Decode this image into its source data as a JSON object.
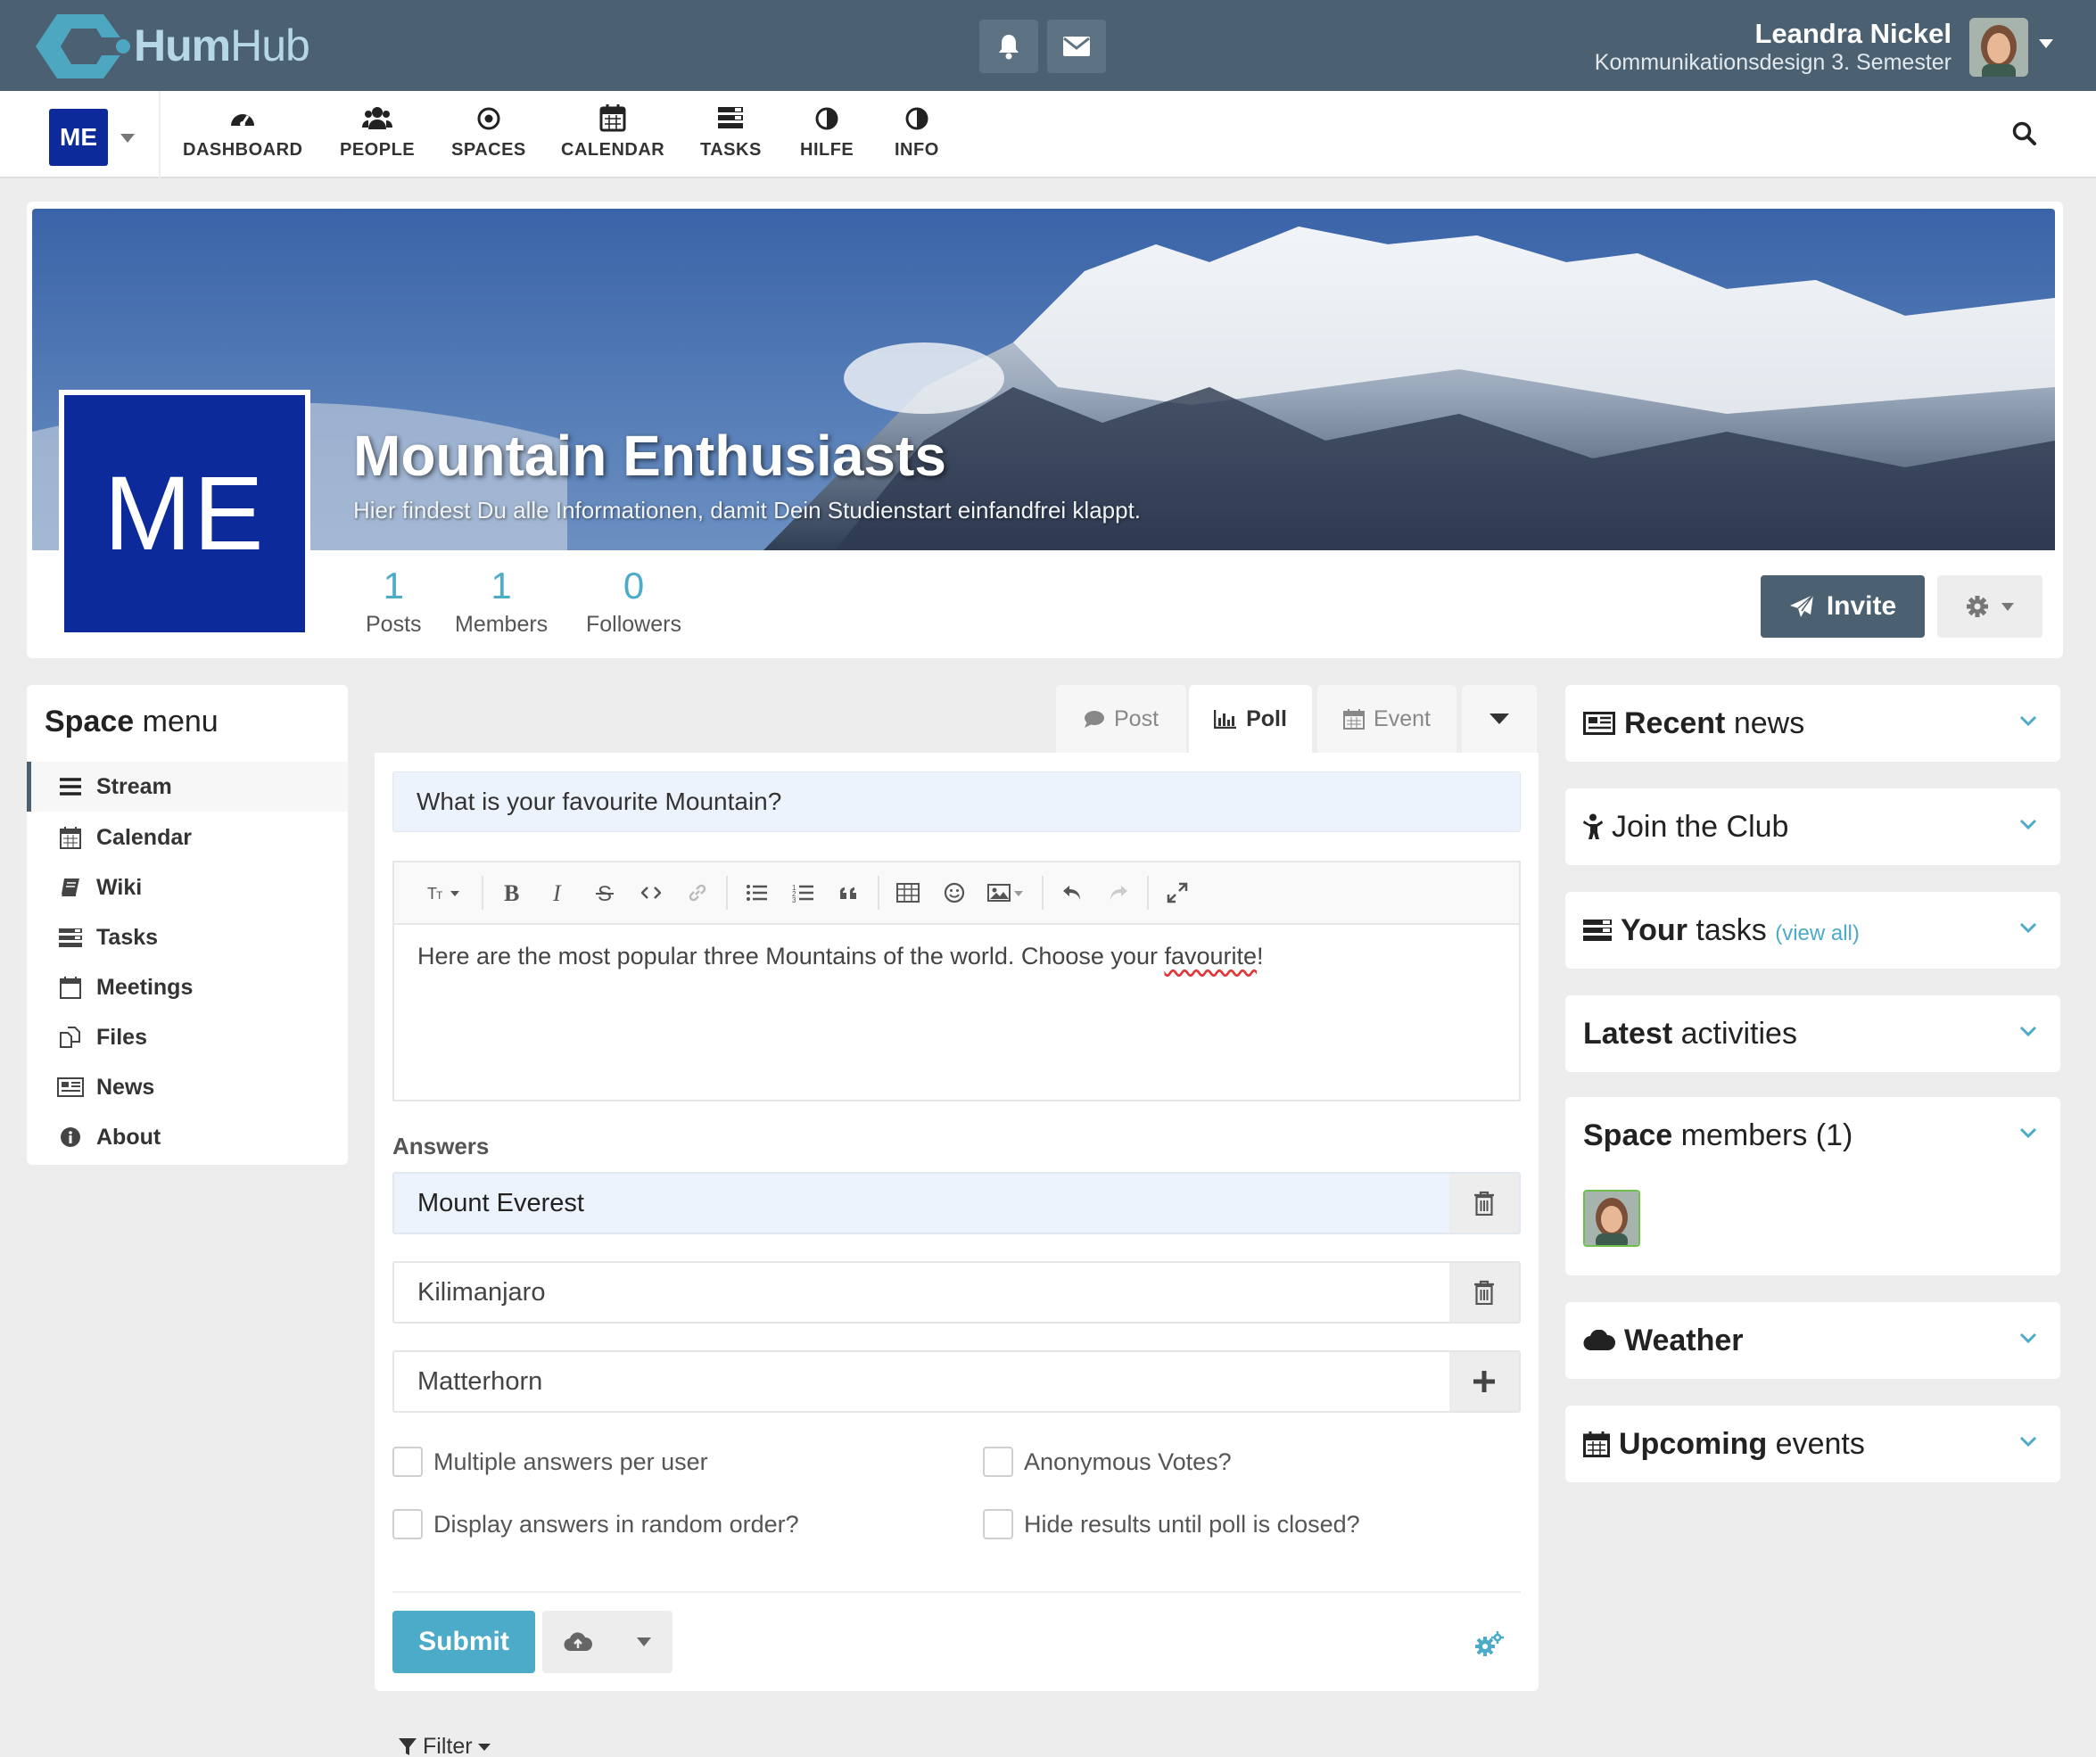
{
  "topbar": {
    "logo_text_bold": "Hum",
    "logo_text_light": "Hub",
    "user_name": "Leandra Nickel",
    "user_subtitle": "Kommunikationsdesign 3. Semester"
  },
  "space_chip": "ME",
  "nav": {
    "items": [
      {
        "label": "DASHBOARD",
        "icon": "dashboard-icon"
      },
      {
        "label": "PEOPLE",
        "icon": "people-icon"
      },
      {
        "label": "SPACES",
        "icon": "spaces-icon"
      },
      {
        "label": "CALENDAR",
        "icon": "calendar-icon"
      },
      {
        "label": "TASKS",
        "icon": "tasks-icon"
      },
      {
        "label": "HILFE",
        "icon": "half-circle-icon"
      },
      {
        "label": "INFO",
        "icon": "half-circle-icon"
      }
    ]
  },
  "space": {
    "logo_text": "ME",
    "title": "Mountain Enthusiasts",
    "description": "Hier findest Du alle Informationen, damit Dein Studienstart einfandfrei klappt.",
    "stats": [
      {
        "num": "1",
        "label": "Posts"
      },
      {
        "num": "1",
        "label": "Members"
      },
      {
        "num": "0",
        "label": "Followers"
      }
    ],
    "invite_label": "Invite"
  },
  "space_menu": {
    "title_bold": "Space",
    "title_rest": " menu",
    "items": [
      {
        "label": "Stream",
        "icon": "list-icon"
      },
      {
        "label": "Calendar",
        "icon": "calendar-icon"
      },
      {
        "label": "Wiki",
        "icon": "book-icon"
      },
      {
        "label": "Tasks",
        "icon": "tasks-icon"
      },
      {
        "label": "Meetings",
        "icon": "calendar-empty-icon"
      },
      {
        "label": "Files",
        "icon": "files-icon"
      },
      {
        "label": "News",
        "icon": "newspaper-icon"
      },
      {
        "label": "About",
        "icon": "info-icon"
      }
    ]
  },
  "composer": {
    "tabs": [
      {
        "label": "Post",
        "icon": "comment-icon"
      },
      {
        "label": "Poll",
        "icon": "bar-chart-icon"
      },
      {
        "label": "Event",
        "icon": "calendar-icon"
      }
    ],
    "question": "What is your favourite Mountain?",
    "description_before": "Here are the most popular three Mountains of the world. Choose your ",
    "description_misspelled": "favourite",
    "description_after": "!",
    "answers_label": "Answers",
    "answers": [
      "Mount Everest",
      "Kilimanjaro",
      "Matterhorn"
    ],
    "options": [
      "Multiple answers per user",
      "Anonymous Votes?",
      "Display answers in random order?",
      "Hide results until poll is closed?"
    ],
    "submit_label": "Submit",
    "filter_label": "Filter"
  },
  "sidebar": {
    "recent_news": {
      "bold": "Recent",
      "rest": " news"
    },
    "join_club": "Join the Club",
    "your_tasks": {
      "bold": "Your",
      "rest": " tasks",
      "link": "(view all)"
    },
    "latest_activities": {
      "bold": "Latest",
      "rest": " activities"
    },
    "space_members": {
      "bold": "Space",
      "rest": " members (1)"
    },
    "weather": "Weather",
    "upcoming_events": {
      "bold": "Upcoming",
      "rest": " events"
    }
  },
  "colors": {
    "topbar": "#4b6071",
    "accent": "#4cabc8",
    "space_logo": "#0c2a9a"
  }
}
